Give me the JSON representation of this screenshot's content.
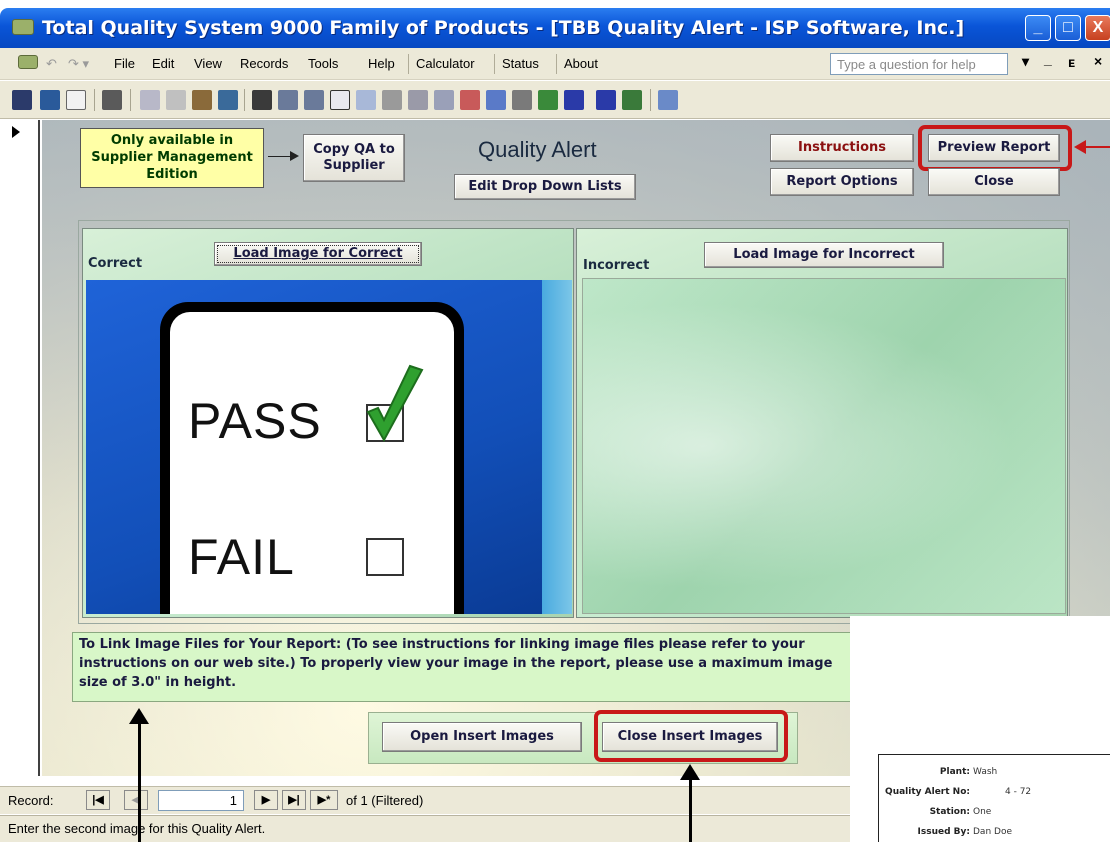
{
  "window": {
    "title": "Total Quality System 9000 Family of Products - [TBB Quality Alert - ISP Software, Inc.]",
    "minimize_glyph": "_",
    "maximize_glyph": "□",
    "close_glyph": "X"
  },
  "menu": {
    "items": [
      "File",
      "Edit",
      "View",
      "Records",
      "Tools",
      "Help",
      "Calculator",
      "Status",
      "About"
    ],
    "help_placeholder": "Type a question for help",
    "restore_glyph": "▾",
    "min_glyph": "_",
    "restore2_glyph": "ᴇ",
    "close_glyph": "×"
  },
  "form": {
    "note": "Only available in Supplier Management Edition",
    "copy_button": "Copy QA to Supplier",
    "title": "Quality Alert",
    "edit_lists_button": "Edit Drop Down Lists",
    "instructions_button": "Instructions",
    "preview_button": "Preview Report",
    "report_options_button": "Report Options",
    "close_button": "Close",
    "correct_label": "Correct",
    "incorrect_label": "Incorrect",
    "load_correct_button": "Load Image for Correct",
    "load_incorrect_button": "Load Image for Incorrect",
    "image_text": {
      "pass": "PASS",
      "fail": "FAIL"
    },
    "info_text": "To Link Image Files for Your Report: (To see instructions for linking image files please refer to your instructions on our web site.) To properly view your image in the report, please use a maximum image size of 3.0\" in height.",
    "open_insert_button": "Open Insert Images",
    "close_insert_button": "Close Insert Images"
  },
  "record_nav": {
    "label": "Record:",
    "current": "1",
    "of_text": "of  1 (Filtered)"
  },
  "status": {
    "text": "Enter the second image for this Quality Alert."
  },
  "report_preview": {
    "rows": [
      {
        "label": "Plant:",
        "value": "Wash"
      },
      {
        "label": "Quality Alert No:",
        "value": "4 - 72"
      },
      {
        "label": "Station:",
        "value": "One"
      },
      {
        "label": "Issued By:",
        "value": "Dan Doe"
      }
    ]
  },
  "colors": {
    "title_bar": "#0a55d8",
    "highlight": "#c81818",
    "note_bg": "#ffffa6",
    "info_bg": "#d8f7c8"
  }
}
